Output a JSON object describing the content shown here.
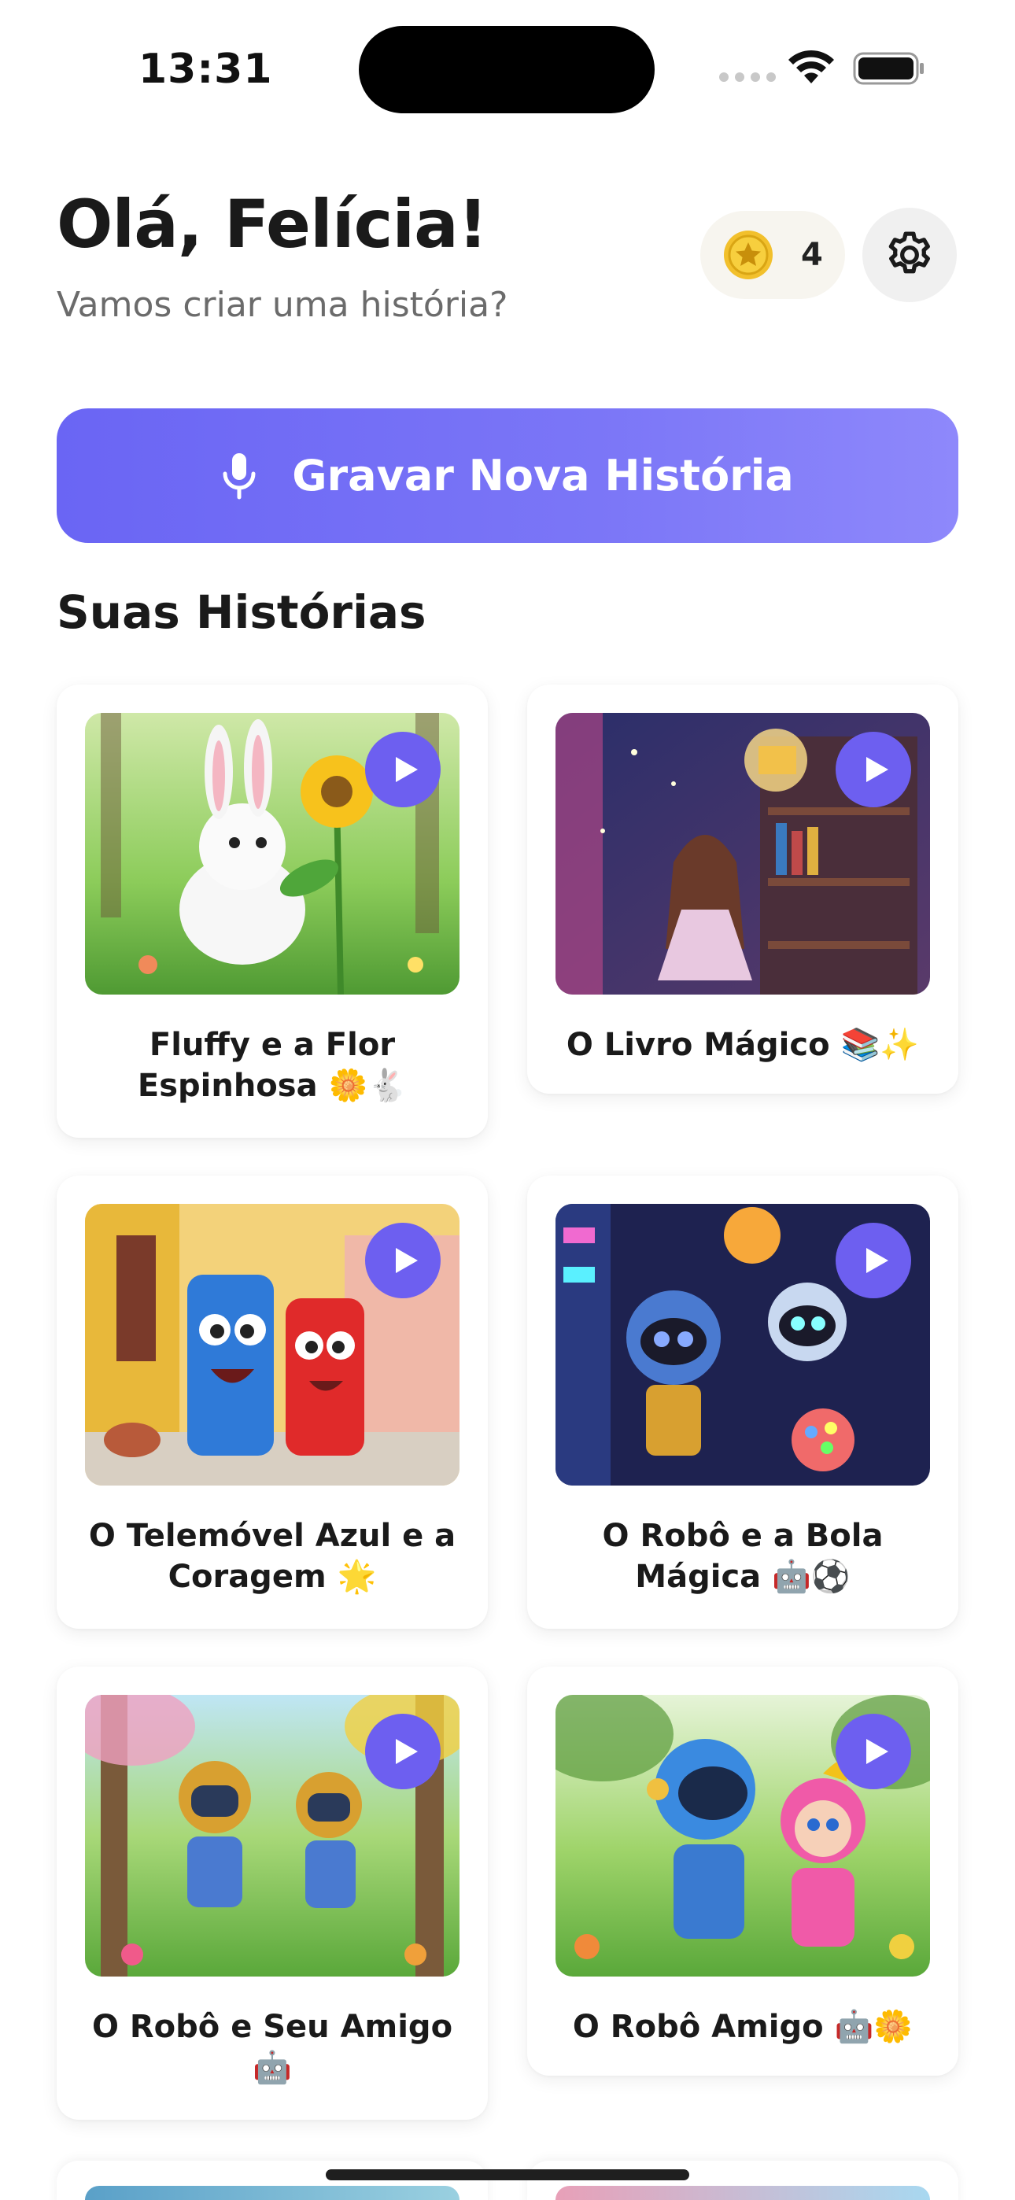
{
  "status_bar": {
    "time": "13:31"
  },
  "header": {
    "greeting": "Olá, Felícia!",
    "subtitle": "Vamos criar uma história?",
    "coins": {
      "count": "4",
      "icon": "star-coin-icon"
    },
    "settings_icon": "gear-icon"
  },
  "record_button": {
    "label": "Gravar Nova História",
    "icon": "microphone-icon"
  },
  "section_title": "Suas Histórias",
  "stories": [
    {
      "title": "Fluffy e a Flor Espinhosa 🌼🐇"
    },
    {
      "title": "O Livro Mágico 📚✨"
    },
    {
      "title": "O Telemóvel Azul e a Coragem 🌟"
    },
    {
      "title": "O Robô e a Bola Mágica 🤖⚽"
    },
    {
      "title": "O Robô e Seu Amigo 🤖"
    },
    {
      "title": "O Robô Amigo 🤖🌼"
    }
  ],
  "colors": {
    "accent": "#6d5ff0",
    "record_gradient_start": "#6a65f4",
    "record_gradient_end": "#8e88fb",
    "coin": "#f4c430"
  }
}
